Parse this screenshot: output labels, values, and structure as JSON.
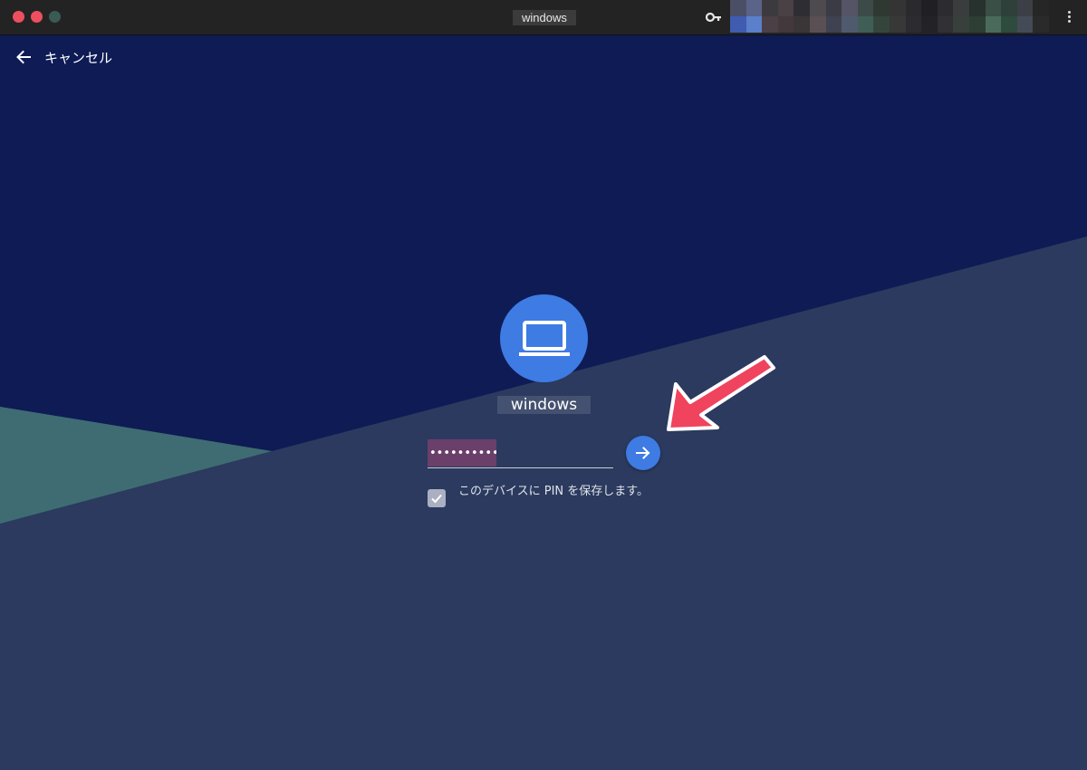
{
  "window": {
    "title": "windows",
    "controls": [
      "close",
      "minimize",
      "maximize"
    ],
    "key_icon": "key-icon",
    "menu_icon": "more-vertical-icon"
  },
  "nav": {
    "cancel_label": "キャンセル",
    "back_icon": "arrow-left-icon"
  },
  "login": {
    "avatar_icon": "laptop-icon",
    "username": "windows",
    "pin_value": "••••••••••",
    "submit_icon": "arrow-right-icon",
    "save_pin_checked": true,
    "save_pin_label": "このデバイスに PIN を保存します。"
  },
  "annotation": {
    "type": "arrow",
    "points_to": "submit-button",
    "color": "#f0435e"
  },
  "colors": {
    "titlebar": "#232323",
    "bg_navy": "#0e1b55",
    "bg_slate": "#2b3a5e",
    "bg_teal": "#3e6c72",
    "accent_blue": "#3e7be3",
    "close": "#ee4f60",
    "pin_highlight": "#6a3f6a"
  }
}
